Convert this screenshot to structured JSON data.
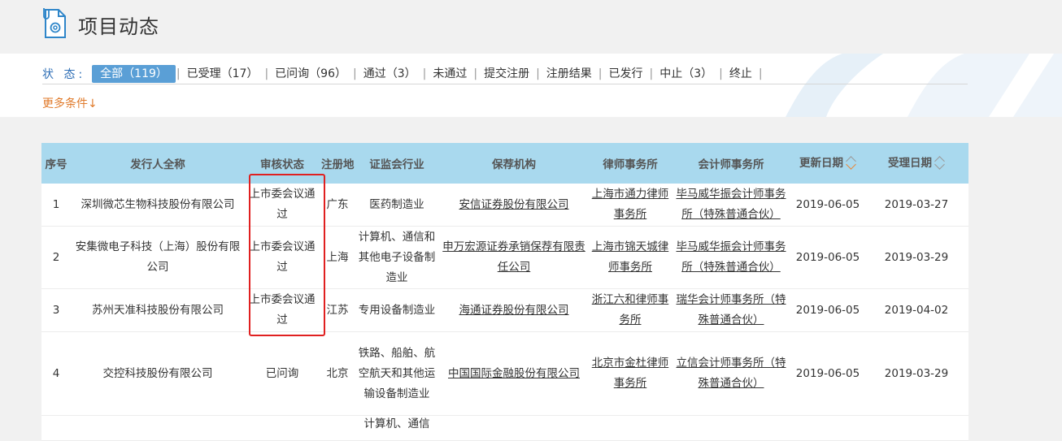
{
  "page": {
    "title": "项目动态"
  },
  "filters": {
    "status_label": "状 态:",
    "options": [
      {
        "label": "全部（119）",
        "active": true
      },
      {
        "label": "已受理（17）"
      },
      {
        "label": "已问询（96）"
      },
      {
        "label": "通过（3）"
      },
      {
        "label": "未通过"
      },
      {
        "label": "提交注册"
      },
      {
        "label": "注册结果"
      },
      {
        "label": "已发行"
      },
      {
        "label": "中止（3）"
      },
      {
        "label": "终止"
      }
    ],
    "more_label": "更多条件↓"
  },
  "table": {
    "headers": [
      "序号",
      "发行人全称",
      "审核状态",
      "注册地",
      "证监会行业",
      "保荐机构",
      "律师事务所",
      "会计师事务所",
      "更新日期",
      "受理日期"
    ],
    "rows": [
      {
        "no": "1",
        "issuer": "深圳微芯生物科技股份有限公司",
        "status": "上市委会议通过",
        "region": "广东",
        "industry": "医药制造业",
        "sponsor": "安信证券股份有限公司",
        "law_firm": "上海市通力律师事务所",
        "accounting_firm": "毕马威华振会计师事务所（特殊普通合伙）",
        "updated": "2019-06-05",
        "accepted": "2019-03-27"
      },
      {
        "no": "2",
        "issuer": "安集微电子科技（上海）股份有限公司",
        "status": "上市委会议通过",
        "region": "上海",
        "industry": "计算机、通信和其他电子设备制造业",
        "sponsor": "申万宏源证券承销保荐有限责任公司",
        "law_firm": "上海市锦天城律师事务所",
        "accounting_firm": "毕马威华振会计师事务所（特殊普通合伙）",
        "updated": "2019-06-05",
        "accepted": "2019-03-29"
      },
      {
        "no": "3",
        "issuer": "苏州天准科技股份有限公司",
        "status": "上市委会议通过",
        "region": "江苏",
        "industry": "专用设备制造业",
        "sponsor": "海通证券股份有限公司",
        "law_firm": "浙江六和律师事务所",
        "accounting_firm": "瑞华会计师事务所（特殊普通合伙）",
        "updated": "2019-06-05",
        "accepted": "2019-04-02"
      },
      {
        "no": "4",
        "issuer": "交控科技股份有限公司",
        "status": "已问询",
        "region": "北京",
        "industry": "铁路、船舶、航空航天和其他运输设备制造业",
        "sponsor": "中国国际金融股份有限公司",
        "law_firm": "北京市金杜律师事务所",
        "accounting_firm": "立信会计师事务所（特殊普通合伙）",
        "updated": "2019-06-05",
        "accepted": "2019-03-29"
      },
      {
        "no": "",
        "issuer": "",
        "status": "",
        "region": "",
        "industry": "计算机、通信",
        "sponsor": "",
        "law_firm": "",
        "accounting_firm": "",
        "updated": "",
        "accepted": ""
      }
    ]
  }
}
